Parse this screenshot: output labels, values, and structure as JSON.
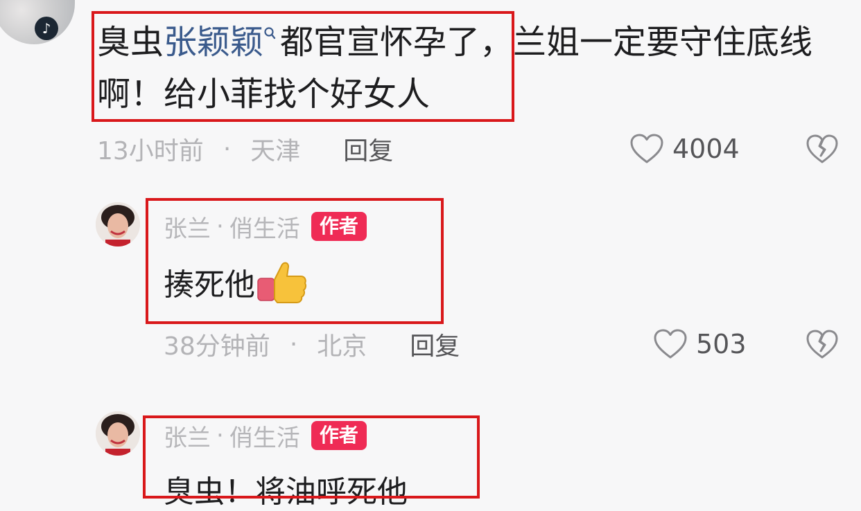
{
  "top_comment": {
    "avatar_badge": "♪",
    "text_part1": "臭虫",
    "mention": "张颖颖",
    "text_part2": "都官宣怀孕了，兰姐一定要守住底线啊！给小菲找个好女人",
    "time": "13小时前",
    "dot": "·",
    "location": "天津",
    "reply_label": "回复",
    "like_count": "4004"
  },
  "replies": [
    {
      "author": "张兰",
      "dot": "·",
      "author_suffix": "俏生活",
      "badge": "作者",
      "text": "揍死他",
      "time": "38分钟前",
      "meta_dot": "·",
      "location": "北京",
      "reply_label": "回复",
      "like_count": "503"
    },
    {
      "author": "张兰",
      "dot": "·",
      "author_suffix": "俏生活",
      "badge": "作者",
      "text": "臭虫！将油呼死他"
    }
  ],
  "colors": {
    "highlight_border": "#d9181b",
    "author_badge": "#ef2b55",
    "mention": "#3a5a8c"
  },
  "icons": [
    "tiktok-icon",
    "search-icon",
    "heart-icon",
    "broken-heart-icon",
    "thumbs-up-icon"
  ]
}
